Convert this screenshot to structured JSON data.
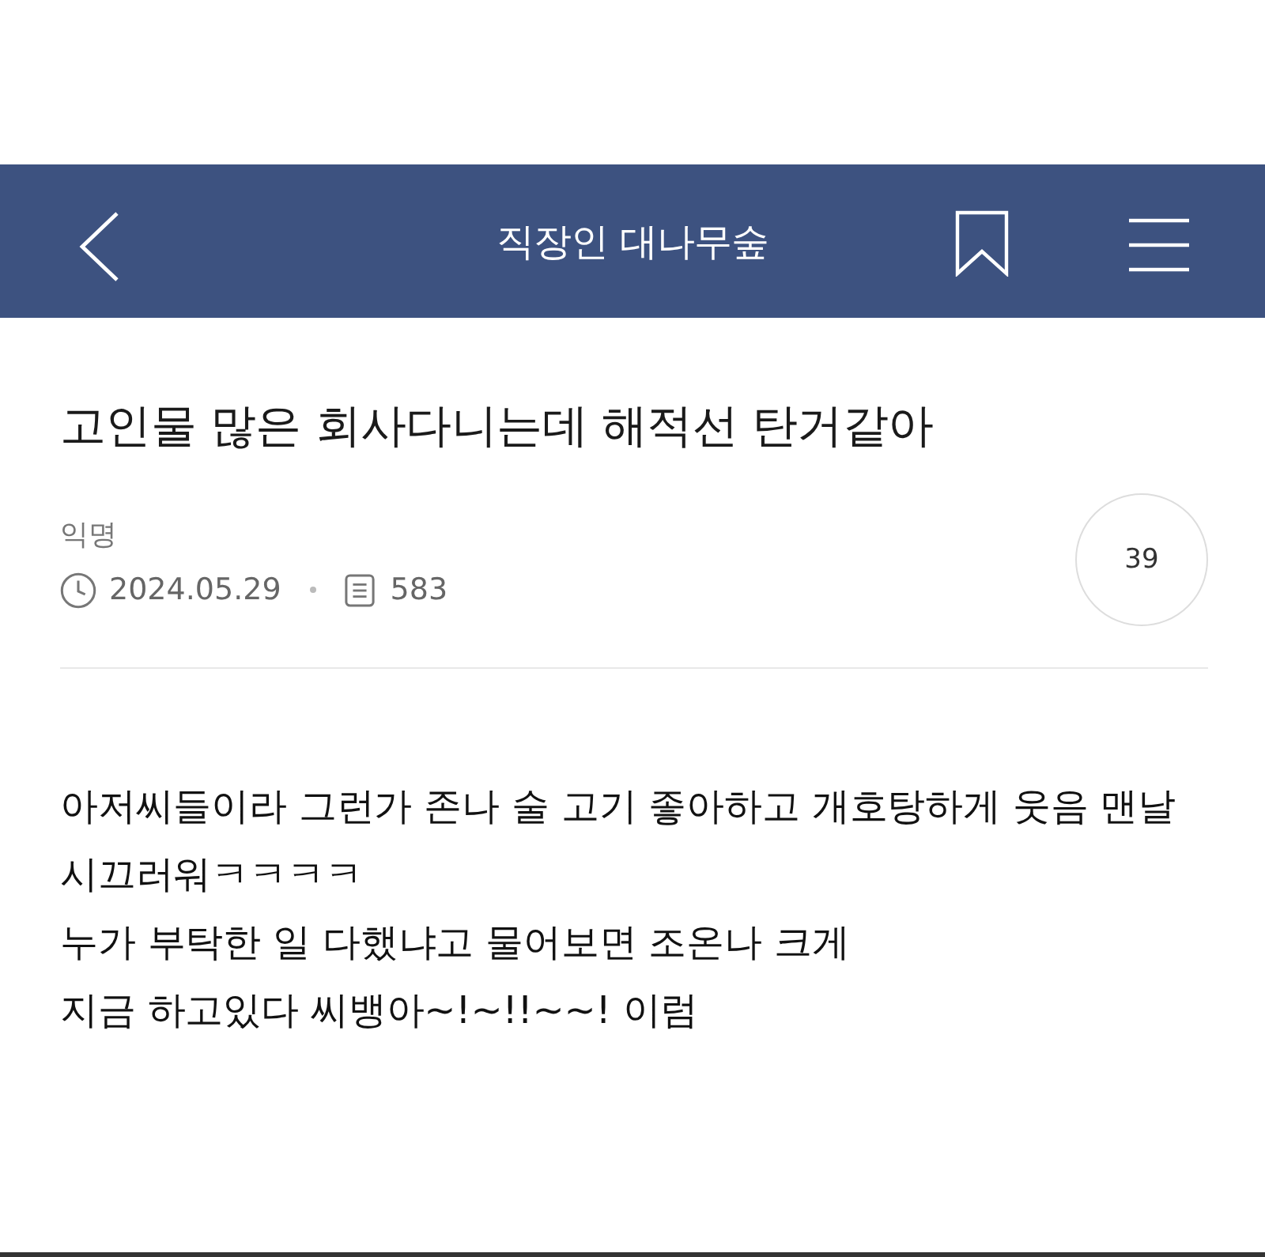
{
  "header": {
    "title": "직장인 대나무숲"
  },
  "post": {
    "title": "고인물 많은 회사다니는데 해적선 탄거같아",
    "author": "익명",
    "date": "2024.05.29",
    "views": "583",
    "comment_count": "39"
  },
  "body": {
    "lines": [
      "아저씨들이라 그런가 존나 술 고기 좋아하고 개호탕하게 웃음 맨날",
      "시끄러워ㅋㅋㅋㅋ",
      "누가 부탁한 일 다했냐고 물어보면 조온나 크게",
      "지금 하고있다 씨뱅아~!~!!~~! 이럼"
    ]
  }
}
